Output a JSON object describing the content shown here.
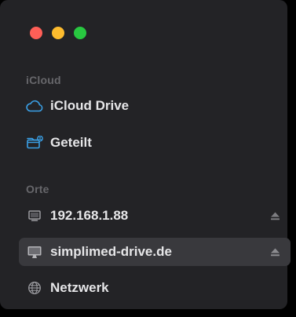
{
  "window": {
    "traffic_lights": [
      "close",
      "minimize",
      "zoom"
    ]
  },
  "sections": {
    "icloud": {
      "label": "iCloud",
      "items": [
        {
          "label": "iCloud Drive",
          "icon": "cloud-icon"
        },
        {
          "label": "Geteilt",
          "icon": "shared-folder-icon"
        }
      ]
    },
    "orte": {
      "label": "Orte",
      "items": [
        {
          "label": "192.168.1.88",
          "icon": "display-icon",
          "eject": true
        },
        {
          "label": "simplimed-drive.de",
          "icon": "display-icon",
          "eject": true,
          "selected": true
        },
        {
          "label": "Netzwerk",
          "icon": "globe-icon"
        }
      ]
    }
  },
  "colors": {
    "accent": "#3aa0e6",
    "background": "#232326",
    "selected": "#39393d"
  }
}
